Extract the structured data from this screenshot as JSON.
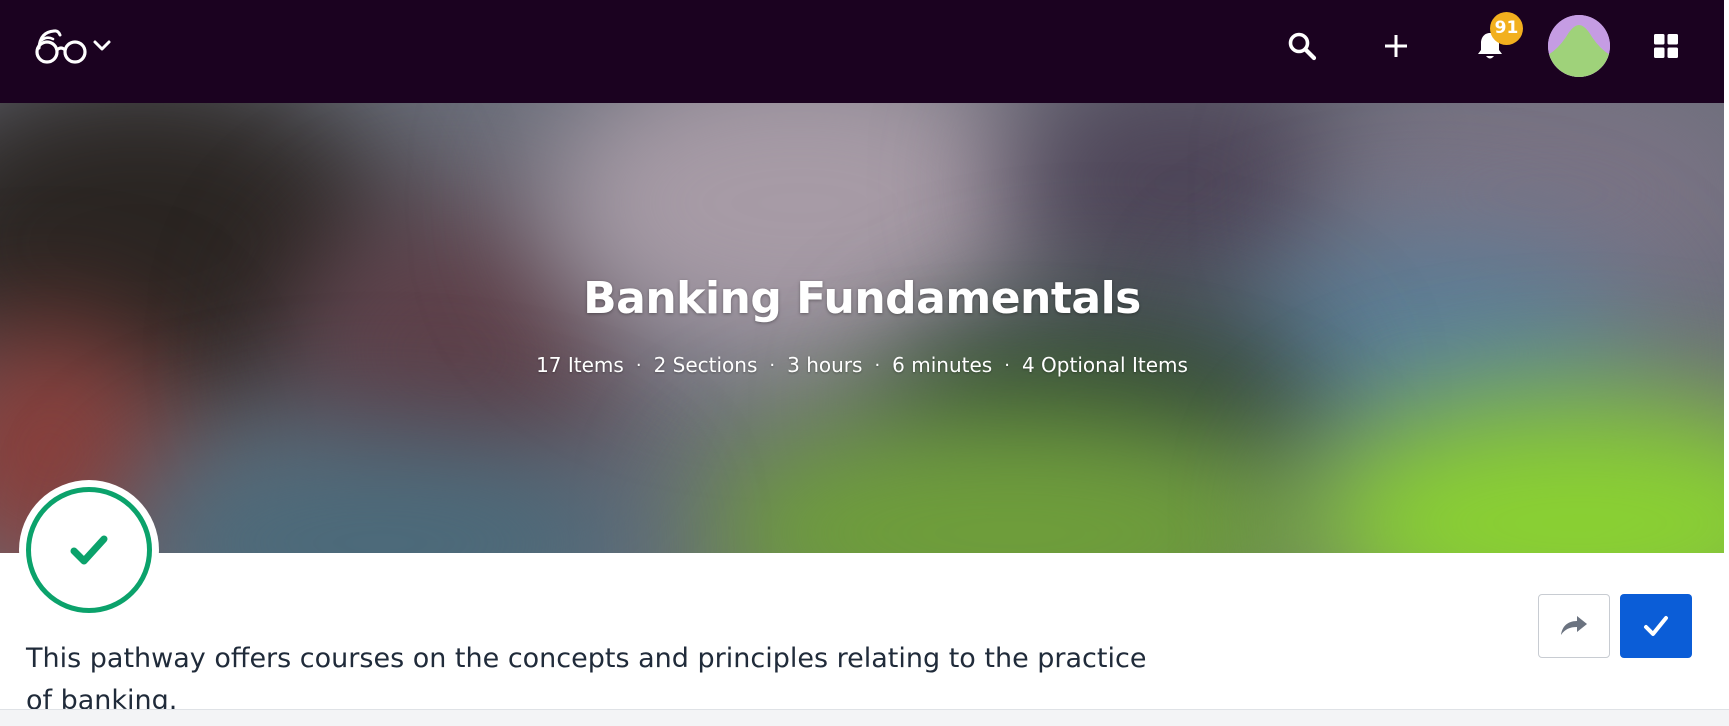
{
  "topbar": {
    "logo_icon": "glasses-logo-icon",
    "menu_icon": "chevron-down-icon",
    "search_icon": "search-icon",
    "add_icon": "plus-icon",
    "notifications_icon": "bell-icon",
    "notifications_count": "91",
    "apps_icon": "grid-icon",
    "background_color": "#1b0220"
  },
  "hero": {
    "title": "Banking Fundamentals",
    "meta": {
      "items": "17 Items",
      "sections": "2 Sections",
      "hours": "3 hours",
      "minutes": "6 minutes",
      "optional": "4 Optional Items",
      "separator": "·"
    }
  },
  "status": {
    "completed_icon": "checkmark-icon",
    "accent_color": "#0ba26b"
  },
  "actions": {
    "share_icon": "share-arrow-icon",
    "mark_complete_icon": "checkmark-icon",
    "primary_color": "#0b5dd7"
  },
  "description": "This pathway offers courses on the concepts and principles relating to the practice of banking."
}
